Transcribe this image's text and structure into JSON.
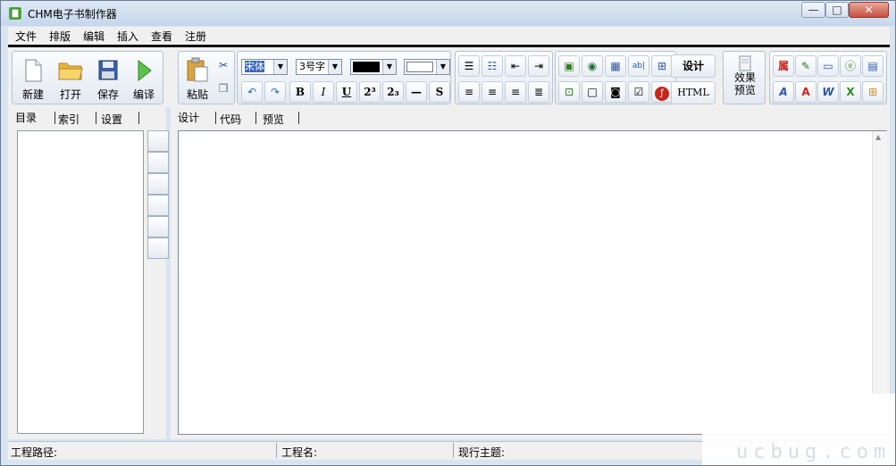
{
  "window": {
    "title": "CHM电子书制作器"
  },
  "menu": [
    "文件",
    "排版",
    "编辑",
    "插入",
    "查看",
    "注册"
  ],
  "toolbar": {
    "file_buttons": [
      {
        "name": "new-button",
        "label": "新建",
        "icon": "new-doc-icon"
      },
      {
        "name": "open-button",
        "label": "打开",
        "icon": "folder-icon"
      },
      {
        "name": "save-button",
        "label": "保存",
        "icon": "floppy-icon"
      },
      {
        "name": "compile-button",
        "label": "编译",
        "icon": "play-icon"
      }
    ],
    "paste_label": "粘贴",
    "font_name": "宋体",
    "font_size": "3号字",
    "font_color": "#000000",
    "back_color": "#ffffff",
    "design_label": "设计",
    "html_label": "HTML",
    "preview_label": "效果预览",
    "format": {
      "bold": "B",
      "italic": "I",
      "underline": "U",
      "sup": "2³",
      "sub": "2₃",
      "hr": "—",
      "strike": "S"
    }
  },
  "left_tabs": [
    "目录",
    "索引",
    "设置"
  ],
  "editor_tabs": [
    "设计",
    "代码",
    "预览"
  ],
  "status": {
    "project_path_label": "工程路径:",
    "project_name_label": "工程名:",
    "current_topic_label": "现行主题:"
  },
  "watermark": "ucbug.com"
}
